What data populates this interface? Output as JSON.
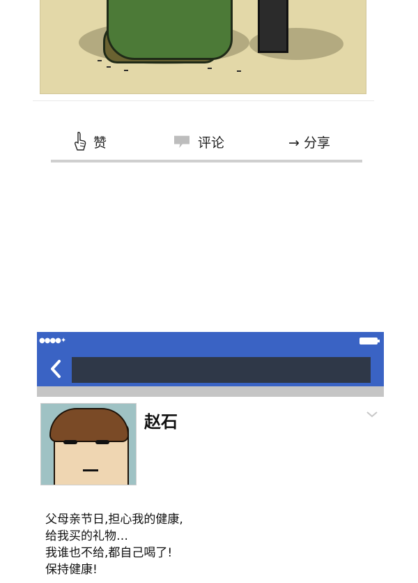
{
  "actions": {
    "like_label": "赞",
    "comment_label": "评论",
    "share_label": "→ 分享"
  },
  "profile": {
    "name": "赵石"
  },
  "post": {
    "lines": [
      "父母亲节日,担心我的健康,",
      "给我买的礼物…",
      "我谁也不给,都自己喝了!",
      "保持健康!"
    ]
  },
  "colors": {
    "header_blue": "#3a63c4",
    "title_bar": "#2f3848",
    "panel_bg": "#e3d8a8"
  },
  "icons": [
    "hand-point-icon",
    "comment-bubble-icon",
    "back-arrow-icon",
    "chevron-down-icon",
    "signal-icon",
    "battery-icon"
  ]
}
